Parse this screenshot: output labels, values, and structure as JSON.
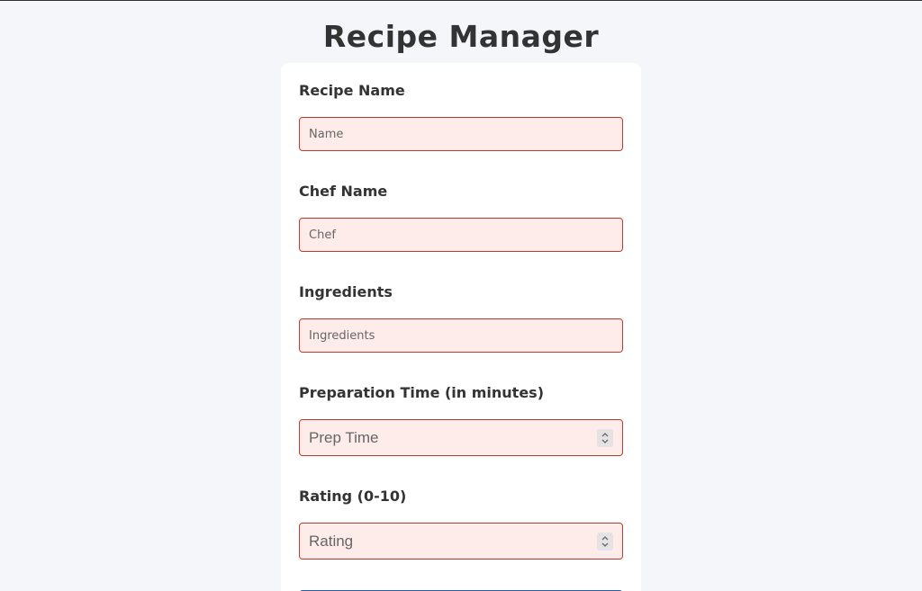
{
  "page": {
    "title": "Recipe Manager"
  },
  "form": {
    "recipe_name": {
      "label": "Recipe Name",
      "placeholder": "Name",
      "value": ""
    },
    "chef_name": {
      "label": "Chef Name",
      "placeholder": "Chef",
      "value": ""
    },
    "ingredients": {
      "label": "Ingredients",
      "placeholder": "Ingredients",
      "value": ""
    },
    "prep_time": {
      "label": "Preparation Time (in minutes)",
      "placeholder": "Prep Time",
      "value": ""
    },
    "rating": {
      "label": "Rating (0-10)",
      "placeholder": "Rating",
      "value": ""
    }
  },
  "colors": {
    "page_background": "#f5f6fa",
    "card_background": "#ffffff",
    "input_invalid_background": "#fdecea",
    "input_invalid_border": "#c0392b",
    "submit_button": "#2c5aa0"
  },
  "icons": {
    "spinner": "up-down-chevron-icon"
  }
}
